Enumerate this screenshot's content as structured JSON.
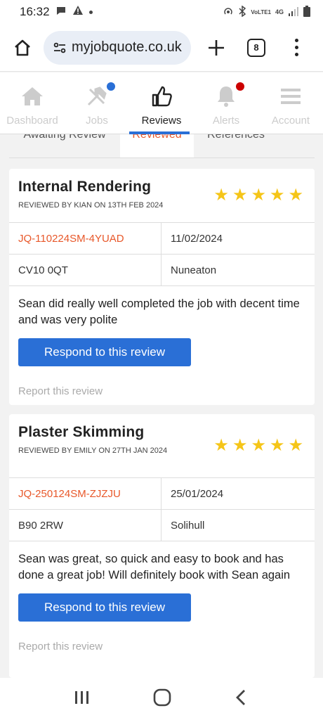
{
  "status_bar": {
    "time": "16:32",
    "network_label": "4G",
    "volte_label": "VoLTE1"
  },
  "browser": {
    "url": "myjobquote.co.uk",
    "tab_count": "8"
  },
  "app_nav": {
    "items": [
      {
        "label": "Dashboard",
        "icon": "home-icon",
        "active": false,
        "badge": null
      },
      {
        "label": "Jobs",
        "icon": "hammer-icon",
        "active": false,
        "badge": "#2a6fd6"
      },
      {
        "label": "Reviews",
        "icon": "thumbs-up-icon",
        "active": true,
        "badge": null
      },
      {
        "label": "Alerts",
        "icon": "bell-icon",
        "active": false,
        "badge": "#cc0000"
      },
      {
        "label": "Account",
        "icon": "hamburger-icon",
        "active": false,
        "badge": null
      }
    ]
  },
  "subtabs": [
    {
      "label": "Awaiting Review",
      "active": false
    },
    {
      "label": "Reviewed",
      "active": true
    },
    {
      "label": "References",
      "active": false
    }
  ],
  "reviews": [
    {
      "title": "Internal Rendering",
      "reviewed_by": "REVIEWED BY KIAN ON 13TH FEB 2024",
      "stars": 5,
      "job_ref": "JQ-110224SM-4YUAD",
      "date": "11/02/2024",
      "postcode": "CV10 0QT",
      "town": "Nuneaton",
      "text": "Sean did really well completed the job with decent time and was very polite",
      "respond_label": "Respond to this review",
      "report_label": "Report this review"
    },
    {
      "title": "Plaster Skimming",
      "reviewed_by": "REVIEWED BY EMILY ON 27TH JAN 2024",
      "stars": 5,
      "job_ref": "JQ-250124SM-ZJZJU",
      "date": "25/01/2024",
      "postcode": "B90 2RW",
      "town": "Solihull",
      "text": "Sean was great, so quick and easy to book and has done a great job! Will definitely book with Sean again",
      "respond_label": "Respond to this review",
      "report_label": "Report this review"
    }
  ],
  "colors": {
    "accent": "#2a6fd6",
    "ref": "#e8582a",
    "star": "#f5c518",
    "alert_badge": "#cc0000"
  }
}
